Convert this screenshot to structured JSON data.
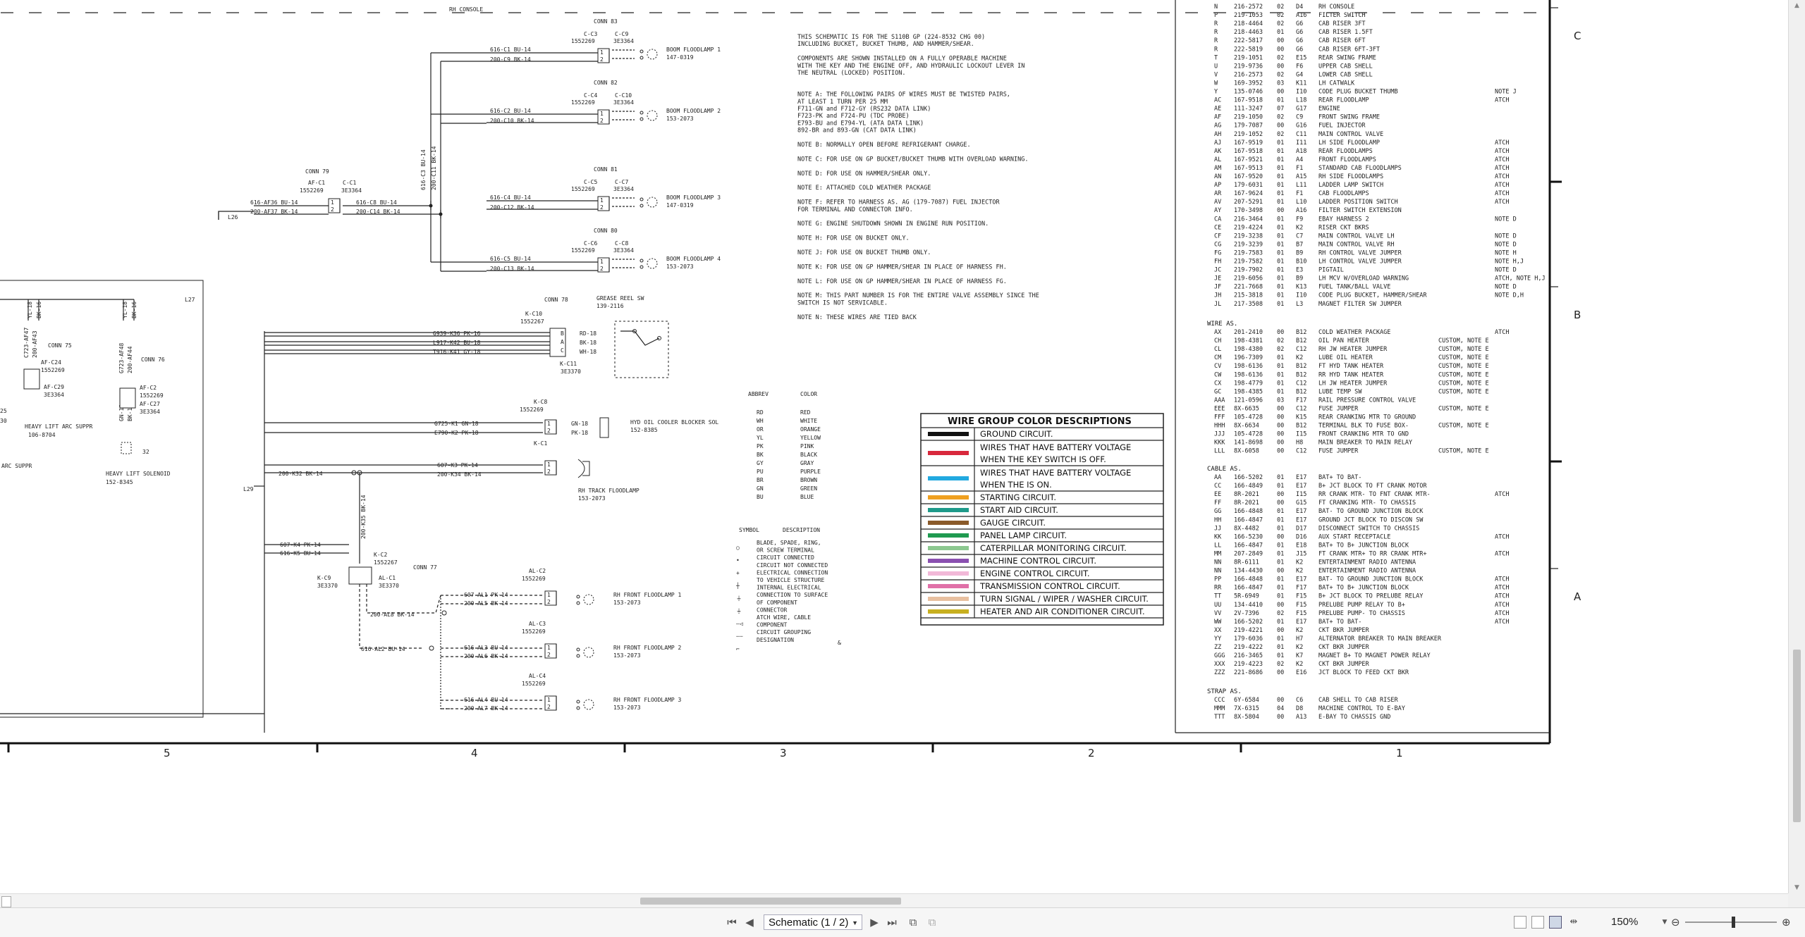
{
  "header": {
    "rh_console": "RH CONSOLE"
  },
  "row_letters": [
    "C",
    "B",
    "A"
  ],
  "column_numbers": [
    "5",
    "4",
    "3",
    "2",
    "1"
  ],
  "notes": [
    "THIS SCHEMATIC IS FOR THE S110B GP (224-8532 CHG 00)",
    "INCLUDING BUCKET, BUCKET THUMB, AND HAMMER/SHEAR.",
    "",
    "COMPONENTS ARE SHOWN INSTALLED ON A FULLY OPERABLE MACHINE",
    "WITH THE KEY AND THE ENGINE OFF, AND HYDRAULIC LOCKOUT LEVER IN",
    "THE NEUTRAL (LOCKED) POSITION.",
    "",
    "",
    "NOTE A: THE FOLLOWING PAIRS OF WIRES MUST BE TWISTED PAIRS,",
    "        AT LEAST 1 TURN PER 25 MM",
    "          F711-GN and F712-GY      (RS232 DATA LINK)",
    "          F723-PK and F724-PU      (TDC PROBE)",
    "          E793-BU and E794-YL      (ATA DATA LINK)",
    "          892-BR and 893-GN        (CAT DATA LINK)",
    "",
    "NOTE B: NORMALLY OPEN BEFORE REFRIGERANT CHARGE.",
    "",
    "NOTE C: FOR USE ON GP BUCKET/BUCKET THUMB WITH OVERLOAD WARNING.",
    "",
    "NOTE D: FOR USE ON HAMMER/SHEAR ONLY.",
    "",
    "NOTE E: ATTACHED COLD WEATHER PACKAGE",
    "",
    "NOTE F: REFER TO HARNESS AS. AG (179-7087) FUEL INJECTOR",
    "        FOR TERMINAL AND CONNECTOR INFO.",
    "",
    "NOTE G: ENGINE SHUTDOWN SHOWN IN ENGINE RUN POSITION.",
    "",
    "NOTE H: FOR USE ON BUCKET ONLY.",
    "",
    "NOTE J: FOR USE ON BUCKET THUMB ONLY.",
    "",
    "NOTE K: FOR USE ON GP HAMMER/SHEAR IN PLACE OF HARNESS FH.",
    "",
    "NOTE L: FOR USE ON GP HAMMER/SHEAR IN PLACE OF HARNESS FG.",
    "",
    "NOTE M: THIS PART NUMBER IS FOR THE ENTIRE VALVE ASSEMBLY SINCE THE",
    "        SWITCH IS NOT SERVICABLE.",
    "",
    "NOTE N: THESE WIRES ARE TIED BACK"
  ],
  "abbrev_header": [
    "ABBREV",
    "COLOR"
  ],
  "abbrev": [
    [
      "RD",
      "RED"
    ],
    [
      "WH",
      "WHITE"
    ],
    [
      "OR",
      "ORANGE"
    ],
    [
      "YL",
      "YELLOW"
    ],
    [
      "PK",
      "PINK"
    ],
    [
      "BK",
      "BLACK"
    ],
    [
      "GY",
      "GRAY"
    ],
    [
      "PU",
      "PURPLE"
    ],
    [
      "BR",
      "BROWN"
    ],
    [
      "GN",
      "GREEN"
    ],
    [
      "BU",
      "BLUE"
    ]
  ],
  "symbol_header": [
    "SYMBOL",
    "DESCRIPTION"
  ],
  "symbols": [
    "BLADE, SPADE, RING,",
    "OR SCREW TERMINAL",
    "CIRCUIT CONNECTED",
    "CIRCUIT NOT CONNECTED",
    "ELECTRICAL CONNECTION",
    "TO VEHICLE STRUCTURE",
    "INTERNAL ELECTRICAL",
    "CONNECTION TO SURFACE",
    "OF COMPONENT",
    "CONNECTOR",
    "ATCH WIRE, CABLE",
    "COMPONENT",
    "CIRCUIT GROUPING",
    "DESIGNATION"
  ],
  "legend": {
    "title": "WIRE GROUP COLOR DESCRIPTIONS",
    "items": [
      {
        "color": "#111111",
        "label": "GROUND CIRCUIT."
      },
      {
        "color": "#d8283c",
        "label": "WIRES THAT HAVE BATTERY VOLTAGE",
        "label2": "WHEN THE KEY SWITCH IS OFF."
      },
      {
        "color": "#22a9e0",
        "label": "WIRES THAT HAVE BATTERY VOLTAGE",
        "label2": "WHEN THE   IS ON."
      },
      {
        "color": "#f0a020",
        "label": "STARTING CIRCUIT."
      },
      {
        "color": "#1f9a8a",
        "label": "START AID CIRCUIT."
      },
      {
        "color": "#8a5a2a",
        "label": "GAUGE CIRCUIT."
      },
      {
        "color": "#1f9a50",
        "label": "PANEL LAMP CIRCUIT."
      },
      {
        "color": "#8cc890",
        "label": "CATERPILLAR MONITORING CIRCUIT."
      },
      {
        "color": "#8a50b0",
        "label": "MACHINE CONTROL CIRCUIT."
      },
      {
        "color": "#f2b8d8",
        "label": "ENGINE CONTROL CIRCUIT."
      },
      {
        "color": "#e070a8",
        "label": "TRANSMISSION CONTROL CIRCUIT."
      },
      {
        "color": "#e8c0a0",
        "label": "TURN SIGNAL / WIPER / WASHER CIRCUIT."
      },
      {
        "color": "#c8b020",
        "label": "HEATER AND AIR CONDITIONER CIRCUIT."
      }
    ]
  },
  "harness_rows": [
    [
      "N",
      "216-2572",
      "02",
      "D4",
      "RH CONSOLE",
      ""
    ],
    [
      "P",
      "219-1053",
      "02",
      "A16",
      "FILTER SWITCH",
      ""
    ],
    [
      "R",
      "218-4464",
      "02",
      "G6",
      "CAB RISER 3FT",
      ""
    ],
    [
      "R",
      "218-4463",
      "01",
      "G6",
      "CAB RISER 1.5FT",
      ""
    ],
    [
      "R",
      "222-5817",
      "00",
      "G6",
      "CAB RISER 6FT",
      ""
    ],
    [
      "R",
      "222-5819",
      "00",
      "G6",
      "CAB RISER 6FT-3FT",
      ""
    ],
    [
      "T",
      "219-1051",
      "02",
      "E15",
      "REAR SWING FRAME",
      ""
    ],
    [
      "U",
      "219-9736",
      "00",
      "F6",
      "UPPER CAB SHELL",
      ""
    ],
    [
      "V",
      "216-2573",
      "02",
      "G4",
      "LOWER CAB SHELL",
      ""
    ],
    [
      "W",
      "169-3952",
      "03",
      "K11",
      "LH CATWALK",
      ""
    ],
    [
      "Y",
      "135-0746",
      "00",
      "I10",
      "CODE PLUG BUCKET THUMB",
      "NOTE J"
    ],
    [
      "AC",
      "167-9518",
      "01",
      "L18",
      "REAR FLOODLAMP",
      "ATCH"
    ],
    [
      "AE",
      "111-3247",
      "07",
      "G17",
      "ENGINE",
      ""
    ],
    [
      "AF",
      "219-1050",
      "02",
      "C9",
      "FRONT SWING FRAME",
      ""
    ],
    [
      "AG",
      "179-7087",
      "00",
      "G16",
      "FUEL INJECTOR",
      ""
    ],
    [
      "AH",
      "219-1052",
      "02",
      "C11",
      "MAIN CONTROL VALVE",
      ""
    ],
    [
      "AJ",
      "167-9519",
      "01",
      "I11",
      "LH SIDE FLOODLAMP",
      "ATCH"
    ],
    [
      "AK",
      "167-9518",
      "01",
      "A18",
      "REAR FLOODLAMPS",
      "ATCH"
    ],
    [
      "AL",
      "167-9521",
      "01",
      "A4",
      "FRONT FLOODLAMPS",
      "ATCH"
    ],
    [
      "AM",
      "167-9513",
      "01",
      "F1",
      "STANDARD CAB FLOODLAMPS",
      "ATCH"
    ],
    [
      "AN",
      "167-9520",
      "01",
      "A15",
      "RH SIDE FLOODLAMPS",
      "ATCH"
    ],
    [
      "AP",
      "179-6031",
      "01",
      "L11",
      "LADDER LAMP SWITCH",
      "ATCH"
    ],
    [
      "AR",
      "167-9624",
      "01",
      "F1",
      "CAB FLOODLAMPS",
      "ATCH"
    ],
    [
      "AV",
      "207-5291",
      "01",
      "L10",
      "LADDER POSITION SWITCH",
      "ATCH"
    ],
    [
      "AY",
      "170-3498",
      "00",
      "A16",
      "FILTER SWITCH EXTENSION",
      ""
    ],
    [
      "CA",
      "216-3464",
      "01",
      "F9",
      "EBAY HARNESS 2",
      "NOTE D"
    ],
    [
      "CE",
      "219-4224",
      "01",
      "K2",
      "RISER CKT BKRS",
      ""
    ],
    [
      "CF",
      "219-3238",
      "01",
      "C7",
      "MAIN CONTROL VALVE LH",
      "NOTE D"
    ],
    [
      "CG",
      "219-3239",
      "01",
      "B7",
      "MAIN CONTROL VALVE RH",
      "NOTE D"
    ],
    [
      "FG",
      "219-7583",
      "01",
      "B9",
      "RH CONTROL VALVE JUMPER",
      "NOTE H"
    ],
    [
      "FH",
      "219-7582",
      "01",
      "B10",
      "LH CONTROL VALVE JUMPER",
      "NOTE H,J"
    ],
    [
      "JC",
      "219-7902",
      "01",
      "E3",
      "PIGTAIL",
      "NOTE D"
    ],
    [
      "JE",
      "219-6056",
      "01",
      "B9",
      "LH MCV W/OVERLOAD WARNING",
      "ATCH, NOTE H,J"
    ],
    [
      "JF",
      "221-7668",
      "01",
      "K13",
      "FUEL TANK/BALL VALVE",
      "NOTE D"
    ],
    [
      "JH",
      "215-3818",
      "01",
      "I10",
      "CODE PLUG BUCKET, HAMMER/SHEAR",
      "NOTE D,H"
    ],
    [
      "JL",
      "217-3508",
      "01",
      "L3",
      "MAGNET FILTER SW JUMPER",
      ""
    ]
  ],
  "wire_as_title": "WIRE AS.",
  "wire_rows": [
    [
      "AX",
      "201-2410",
      "00",
      "B12",
      "COLD WEATHER PACKAGE",
      "ATCH"
    ],
    [
      "CH",
      "198-4381",
      "02",
      "B12",
      "OIL PAN HEATER",
      "CUSTOM, NOTE E"
    ],
    [
      "CL",
      "198-4380",
      "02",
      "C12",
      "RH JW HEATER JUMPER",
      "CUSTOM, NOTE E"
    ],
    [
      "CM",
      "196-7309",
      "01",
      "K2",
      "LUBE OIL HEATER",
      "CUSTOM, NOTE E"
    ],
    [
      "CV",
      "198-6136",
      "01",
      "B12",
      "FT HYD TANK HEATER",
      "CUSTOM, NOTE E"
    ],
    [
      "CW",
      "198-6136",
      "01",
      "B12",
      "RR HYD TANK HEATER",
      "CUSTOM, NOTE E"
    ],
    [
      "CX",
      "198-4779",
      "01",
      "C12",
      "LH JW HEATER JUMPER",
      "CUSTOM, NOTE E"
    ],
    [
      "GC",
      "198-4385",
      "01",
      "B12",
      "LUBE TEMP SW",
      "CUSTOM, NOTE E"
    ],
    [
      "AAA",
      "121-0596",
      "03",
      "F17",
      "RAIL PRESSURE CONTROL VALVE",
      ""
    ],
    [
      "EEE",
      "8X-6635",
      "00",
      "C12",
      "FUSE JUMPER",
      "CUSTOM, NOTE E"
    ],
    [
      "FFF",
      "105-4728",
      "00",
      "K15",
      "REAR CRANKING MTR TO GROUND",
      ""
    ],
    [
      "HHH",
      "8X-6634",
      "00",
      "B12",
      "TERMINAL BLK TO FUSE BOX-",
      "CUSTOM, NOTE E"
    ],
    [
      "JJJ",
      "105-4728",
      "00",
      "I15",
      "FRONT CRANKING MTR TO GND",
      ""
    ],
    [
      "KKK",
      "141-8698",
      "00",
      "H8",
      "MAIN BREAKER TO MAIN RELAY",
      ""
    ],
    [
      "LLL",
      "8X-6058",
      "00",
      "C12",
      "FUSE JUMPER",
      "CUSTOM, NOTE E"
    ]
  ],
  "cable_as_title": "CABLE AS.",
  "cable_rows": [
    [
      "AA",
      "166-5202",
      "01",
      "E17",
      "BAT+ TO BAT-",
      ""
    ],
    [
      "CC",
      "166-4849",
      "01",
      "E17",
      "B+ JCT BLOCK TO FT CRANK MOTOR",
      ""
    ],
    [
      "EE",
      "8R-2021",
      "00",
      "I15",
      "RR CRANK MTR- TO FNT CRANK MTR-",
      "ATCH"
    ],
    [
      "FF",
      "8R-2021",
      "00",
      "G15",
      "FT CRANKING MTR- TO CHASSIS",
      ""
    ],
    [
      "GG",
      "166-4848",
      "01",
      "E17",
      "BAT- TO GROUND JUNCTION BLOCK",
      ""
    ],
    [
      "HH",
      "166-4847",
      "01",
      "E17",
      "GROUND JCT BLOCK TO DISCON SW",
      ""
    ],
    [
      "JJ",
      "8X-4482",
      "01",
      "D17",
      "DISCONNECT SWITCH TO CHASSIS",
      ""
    ],
    [
      "KK",
      "166-5230",
      "00",
      "D16",
      "AUX START RECEPTACLE",
      "ATCH"
    ],
    [
      "LL",
      "166-4847",
      "01",
      "E18",
      "BAT+ TO B+ JUNCTION BLOCK",
      ""
    ],
    [
      "MM",
      "207-2849",
      "01",
      "J15",
      "FT CRANK MTR+ TO RR CRANK MTR+",
      "ATCH"
    ],
    [
      "NN",
      "8R-6111",
      "01",
      "K2",
      "ENTERTAINMENT RADIO ANTENNA",
      ""
    ],
    [
      "NN",
      "134-4430",
      "00",
      "K2",
      "ENTERTAINMENT RADIO ANTENNA",
      ""
    ],
    [
      "PP",
      "166-4848",
      "01",
      "E17",
      "BAT- TO GROUND JUNCTION BLOCK",
      "ATCH"
    ],
    [
      "RR",
      "166-4847",
      "01",
      "F17",
      "BAT+ TO B+ JUNCTION BLOCK",
      "ATCH"
    ],
    [
      "TT",
      "5R-6949",
      "01",
      "F15",
      "B+ JCT BLOCK TO PRELUBE RELAY",
      "ATCH"
    ],
    [
      "UU",
      "134-4410",
      "00",
      "F15",
      "PRELUBE PUMP RELAY TO B+",
      "ATCH"
    ],
    [
      "VV",
      "2V-7396",
      "02",
      "F15",
      "PRELUBE PUMP- TO CHASSIS",
      "ATCH"
    ],
    [
      "WW",
      "166-5202",
      "01",
      "E17",
      "BAT+ TO BAT-",
      "ATCH"
    ],
    [
      "XX",
      "219-4221",
      "00",
      "K2",
      "CKT BKR JUMPER",
      ""
    ],
    [
      "YY",
      "179-6036",
      "01",
      "H7",
      "ALTERNATOR BREAKER TO MAIN BREAKER",
      ""
    ],
    [
      "ZZ",
      "219-4222",
      "01",
      "K2",
      "CKT BKR JUMPER",
      ""
    ],
    [
      "GGG",
      "216-3465",
      "01",
      "K7",
      "MAGNET B+ TO MAGNET POWER RELAY",
      ""
    ],
    [
      "XXX",
      "219-4223",
      "02",
      "K2",
      "CKT BKR JUMPER",
      ""
    ],
    [
      "ZZZ",
      "221-8686",
      "00",
      "E16",
      "JCT BLOCK TO FEED CKT BKR",
      ""
    ]
  ],
  "strap_as_title": "STRAP AS.",
  "strap_rows": [
    [
      "CCC",
      "6Y-6584",
      "00",
      "C6",
      "CAB SHELL TO CAB RISER",
      ""
    ],
    [
      "MMM",
      "7X-6315",
      "04",
      "D8",
      "MACHINE CONTROL TO E-BAY",
      ""
    ],
    [
      "TTT",
      "8X-5804",
      "00",
      "A13",
      "E-BAY TO CHASSIS GND",
      ""
    ]
  ],
  "schematic": {
    "conn83": {
      "title": "CONN 83",
      "tag": "C-C3",
      "tag2": "C-C9",
      "pn": "1552269",
      "pn2": "3E3364",
      "w1": "616-C1  BU-14",
      "w2": "200-C9  BK-14",
      "lamp": "BOOM FLOODLAMP 1",
      "lamp_pn": "147-0319"
    },
    "conn82": {
      "title": "CONN 82",
      "tag": "C-C4",
      "tag2": "C-C10",
      "pn": "1552269",
      "pn2": "3E3364",
      "w1": "616-C2  BU-14",
      "w2": "200-C10  BK-14",
      "lamp": "BOOM FLOODLAMP 2",
      "lamp_pn": "153-2073"
    },
    "conn81": {
      "title": "CONN 81",
      "tag": "C-C5",
      "tag2": "C-C7",
      "pn": "1552269",
      "pn2": "3E3364",
      "w1": "616-C4  BU-14",
      "w2": "200-C12  BK-14",
      "lamp": "BOOM FLOODLAMP 3",
      "lamp_pn": "147-0319"
    },
    "conn80": {
      "title": "CONN 80",
      "tag": "C-C6",
      "tag2": "C-C8",
      "pn": "1552269",
      "pn2": "3E3364",
      "w1": "616-C5  BU-14",
      "w2": "200-C13  BK-14",
      "lamp": "BOOM FLOODLAMP 4",
      "lamp_pn": "153-2073"
    },
    "conn79": {
      "title": "CONN 79",
      "tag": "AF-C1",
      "tag2": "C-C1",
      "pn": "1552269",
      "pn2": "3E3364",
      "w1": "616-AF36  BU-14",
      "w2": "200-AF37  BK-14",
      "w3": "616-C8  BU-14",
      "w4": "200-C14  BK-14",
      "l26": "L26"
    },
    "vert_a": "616-C3  BU-14",
    "vert_b": "200-C11  BK-14",
    "conn78": {
      "title": "CONN 78",
      "tag": "K-C10",
      "pn": "1552267",
      "tag2": "K-C11",
      "pn2": "3E3370",
      "w1": "G939-K36  PK-16",
      "w2": "L917-K42  BU-18",
      "w3": "T916-K41  GY-18",
      "r1": "RD-18",
      "r2": "BK-18",
      "r3": "WH-18",
      "sw": "GREASE REEL SW",
      "sw_pn": "139-2116"
    },
    "k_c8": {
      "tag": "K-C8",
      "pn": "1552269",
      "w1": "G725-K1  GN-18",
      "w2": "E790-K2  PK-18",
      "r1": "GN-18",
      "r2": "PK-18",
      "label": "HYD OIL COOLER BLOCKER SOL",
      "label_pn": "152-8385"
    },
    "k_c1": {
      "tag": "K-C1",
      "w1": "607-K3  PK-14",
      "w2": "200-K34  BK-14",
      "w0": "200-K32  BK-14",
      "label": "RH TRACK FLOODLAMP",
      "label_pn": "153-2073",
      "l29": "L29"
    },
    "k_c2": {
      "tag": "K-C2",
      "pn": "1552267",
      "w1": "607-K4  PK-14",
      "w2": "616-K5  BU-14",
      "vert": "200-K35  BK-14"
    },
    "k_c9": {
      "tag": "K-C9",
      "pn": "3E3370",
      "al": "AL-C1",
      "al_pn": "3E3370",
      "conn": "CONN 77"
    },
    "al_c2": {
      "tag": "AL-C2",
      "pn": "1552269",
      "w1": "607-AL1  PK-14",
      "w2": "200-AL5  BK-14",
      "w0": "200-AL8  BK-14",
      "lamp": "RH FRONT FLOODLAMP 1",
      "lamp_pn": "153-2073"
    },
    "al_c3": {
      "tag": "AL-C3",
      "pn": "1552269",
      "w1": "616-AL3  BU-14",
      "w2": "200-AL6  BK-14",
      "w0": "616-AL2  BU-14",
      "lamp": "RH FRONT FLOODLAMP 2",
      "lamp_pn": "153-2073"
    },
    "al_c4": {
      "tag": "AL-C4",
      "pn": "1552269",
      "w1": "616-AL4  BU-14",
      "w2": "200-AL7  BK-14",
      "lamp": "RH FRONT FLOODLAMP 3",
      "lamp_pn": "153-2073"
    },
    "left": {
      "conn75": "CONN 75",
      "conn76": "CONN 76",
      "af_c24": "AF-C24",
      "af_c24_pn": "1552269",
      "af_c29": "AF-C29",
      "af_c29_pn": "3E3364",
      "af_c2": "AF-C2",
      "af_c2_pn": "1552269",
      "af_c27": "AF-C27",
      "af_c27_pn": "3E3364",
      "arc": "HEAVY LIFT ARC SUPPR",
      "arc_pn": "106-8704",
      "arc2": "ARC SUPPR",
      "sol": "HEAVY LIFT SOLENOID",
      "sol_pn": "152-8345",
      "l27": "L27",
      "n30": "30",
      "n25": "25",
      "n32": "32",
      "v1": "YL-18",
      "v2": "BK-16",
      "v3": "C723-AF47",
      "v4": "200-AF43",
      "v5": "G723-AF48",
      "v6": "200-AF44",
      "v7": "YL-18",
      "v8": "BK-16",
      "v9": "GN-18",
      "v10": "BK-18"
    }
  },
  "statusbar": {
    "page_select": "Schematic (1 / 2)",
    "zoom": "150%"
  },
  "icons": [
    "first-page-icon",
    "prev-page-icon",
    "next-page-icon",
    "last-page-icon",
    "copy-icon",
    "layout-icon",
    "single-page-icon",
    "continuous-icon",
    "two-page-icon",
    "fit-width-icon",
    "zoom-out-icon",
    "zoom-in-icon"
  ]
}
